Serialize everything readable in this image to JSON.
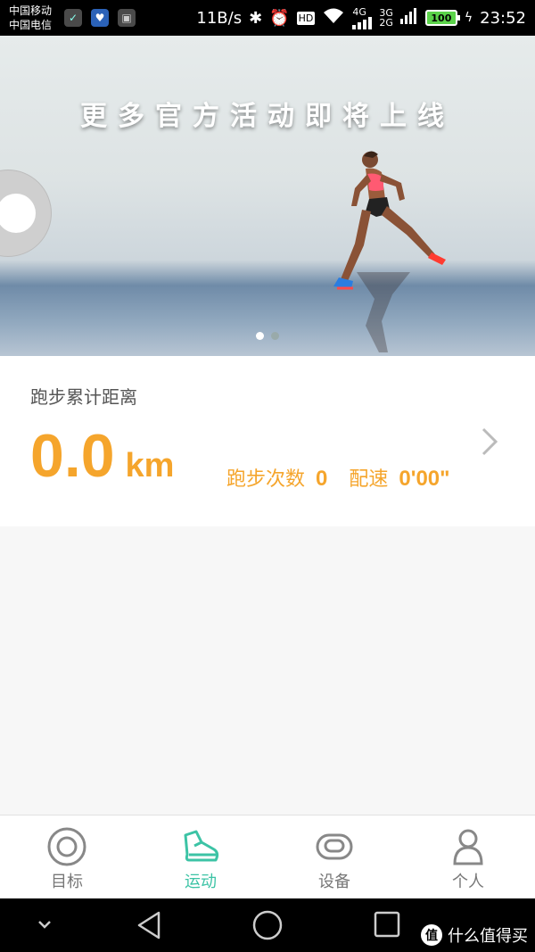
{
  "status_bar": {
    "carrier_1": "中国移动",
    "carrier_2": "中国电信",
    "speed": "11B/s",
    "hd": "HD",
    "net_4g": "4G",
    "net_3g": "3G",
    "net_2g": "2G",
    "battery": "100",
    "time": "23:52",
    "notification_icons": [
      "wechat-icon",
      "health-icon",
      "gallery-icon"
    ]
  },
  "banner": {
    "title": "更多官方活动即将上线",
    "page_count": 2,
    "active_page": 1
  },
  "running": {
    "title": "跑步累计距离",
    "distance": "0.0",
    "unit": "km",
    "count_label": "跑步次数",
    "count_value": "0",
    "pace_label": "配速",
    "pace_value": "0'00\""
  },
  "tabs": [
    {
      "label": "目标",
      "icon": "target-icon",
      "active": false
    },
    {
      "label": "运动",
      "icon": "shoe-icon",
      "active": true
    },
    {
      "label": "设备",
      "icon": "band-icon",
      "active": false
    },
    {
      "label": "个人",
      "icon": "person-icon",
      "active": false
    }
  ],
  "watermark": {
    "badge": "值",
    "text": "什么值得买"
  },
  "colors": {
    "accent": "#f5a52c",
    "active_tab": "#3cc3a5"
  }
}
